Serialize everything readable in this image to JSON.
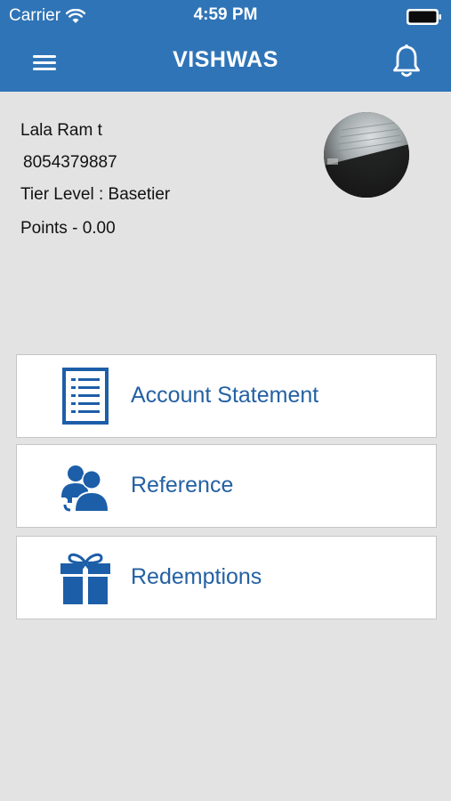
{
  "status_bar": {
    "carrier": "Carrier",
    "time": "4:59 PM",
    "wifi_icon": "wifi-icon",
    "battery_icon": "battery-icon"
  },
  "header": {
    "title": "VISHWAS",
    "menu_icon": "hamburger-menu-icon",
    "bell_icon": "notification-bell-icon",
    "color": "#2f74b7"
  },
  "profile": {
    "name": "Lala Ram t",
    "phone": "8054379887",
    "tier": "Tier Level :  Basetier",
    "points": "Points - 0.00",
    "avatar_icon": "profile-photo"
  },
  "menu": [
    {
      "label": "Account Statement",
      "icon": "document-list-icon"
    },
    {
      "label": "Reference",
      "icon": "users-refer-icon"
    },
    {
      "label": "Redemptions",
      "icon": "gift-icon"
    }
  ],
  "colors": {
    "accent": "#2f74b7",
    "menu_text": "#2461a3",
    "icon": "#1d5ea8",
    "background": "#e3e3e3"
  }
}
